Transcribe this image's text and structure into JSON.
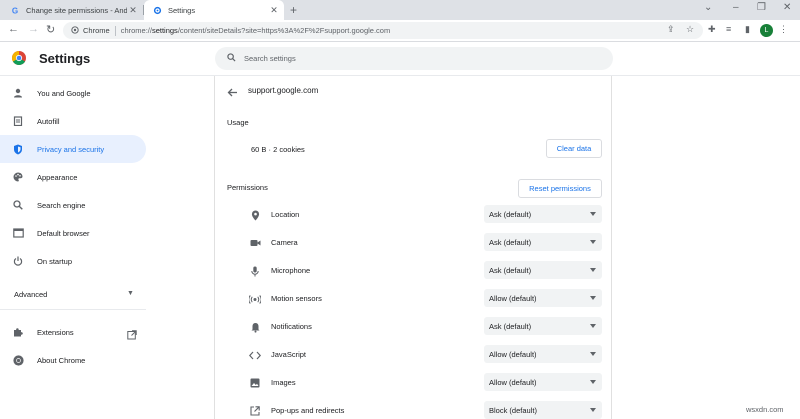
{
  "browser": {
    "tabs": [
      {
        "title": "Change site permissions - Andro",
        "icon": "google-g-icon",
        "active": false
      },
      {
        "title": "Settings",
        "icon": "gear-icon",
        "active": true
      }
    ],
    "omnibox": {
      "chip": "Chrome",
      "url_prefix": "chrome://",
      "url_host": "settings",
      "url_rest": "/content/siteDetails?site=https%3A%2F%2Fsupport.google.com"
    },
    "profile_initial": "L"
  },
  "settings_header": {
    "title": "Settings",
    "search_placeholder": "Search settings"
  },
  "sidebar": {
    "items": [
      {
        "label": "You and Google",
        "icon": "person-icon"
      },
      {
        "label": "Autofill",
        "icon": "autofill-clipboard-icon"
      },
      {
        "label": "Privacy and security",
        "icon": "shield-icon",
        "active": true
      },
      {
        "label": "Appearance",
        "icon": "palette-icon"
      },
      {
        "label": "Search engine",
        "icon": "search-icon"
      },
      {
        "label": "Default browser",
        "icon": "browser-window-icon"
      },
      {
        "label": "On startup",
        "icon": "power-icon"
      }
    ],
    "advanced_label": "Advanced",
    "bottom_items": [
      {
        "label": "Extensions",
        "icon": "puzzle-icon"
      },
      {
        "label": "About Chrome",
        "icon": "chrome-logo-icon"
      }
    ]
  },
  "site_details": {
    "site": "support.google.com",
    "usage_label": "Usage",
    "usage_value": "60 B · 2 cookies",
    "clear_data_label": "Clear data",
    "permissions_label": "Permissions",
    "reset_permissions_label": "Reset permissions",
    "permissions": [
      {
        "label": "Location",
        "value": "Ask (default)",
        "icon": "location-pin-icon"
      },
      {
        "label": "Camera",
        "value": "Ask (default)",
        "icon": "camera-icon"
      },
      {
        "label": "Microphone",
        "value": "Ask (default)",
        "icon": "microphone-icon"
      },
      {
        "label": "Motion sensors",
        "value": "Allow (default)",
        "icon": "motion-sensors-icon"
      },
      {
        "label": "Notifications",
        "value": "Ask (default)",
        "icon": "bell-icon"
      },
      {
        "label": "JavaScript",
        "value": "Allow (default)",
        "icon": "code-icon"
      },
      {
        "label": "Images",
        "value": "Allow (default)",
        "icon": "image-icon"
      },
      {
        "label": "Pop-ups and redirects",
        "value": "Block (default)",
        "icon": "popup-icon"
      }
    ]
  },
  "watermark": "wsxdn.com",
  "colors": {
    "accent": "#1a73e8",
    "active_bg": "#e8f0fe",
    "select_bg": "#f1f3f4"
  }
}
